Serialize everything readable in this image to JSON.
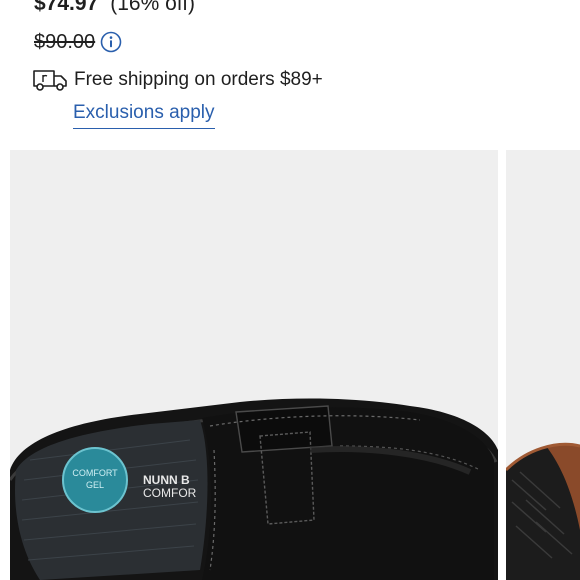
{
  "pricing": {
    "sale_price": "$74.97",
    "discount": "(16% off)",
    "original_price": "$90.00",
    "info_icon": "info-circle-icon"
  },
  "shipping": {
    "icon": "truck-icon",
    "text": "Free shipping on orders $89+",
    "exclusions_link": "Exclusions apply"
  },
  "product_images": {
    "main_alt_icon": "black-penny-loafer-top-view",
    "insole_brand_lines": [
      "NUNN B",
      "COMFOR"
    ],
    "insole_badge_lines": [
      "COMFORT",
      "GEL"
    ],
    "next_preview": "shoe-outsole-preview"
  },
  "colors": {
    "text": "#1f1f1f",
    "link": "#2a5fad",
    "image_bg": "#efefef",
    "shoe": "#141414",
    "badge": "#2a8a9a"
  }
}
